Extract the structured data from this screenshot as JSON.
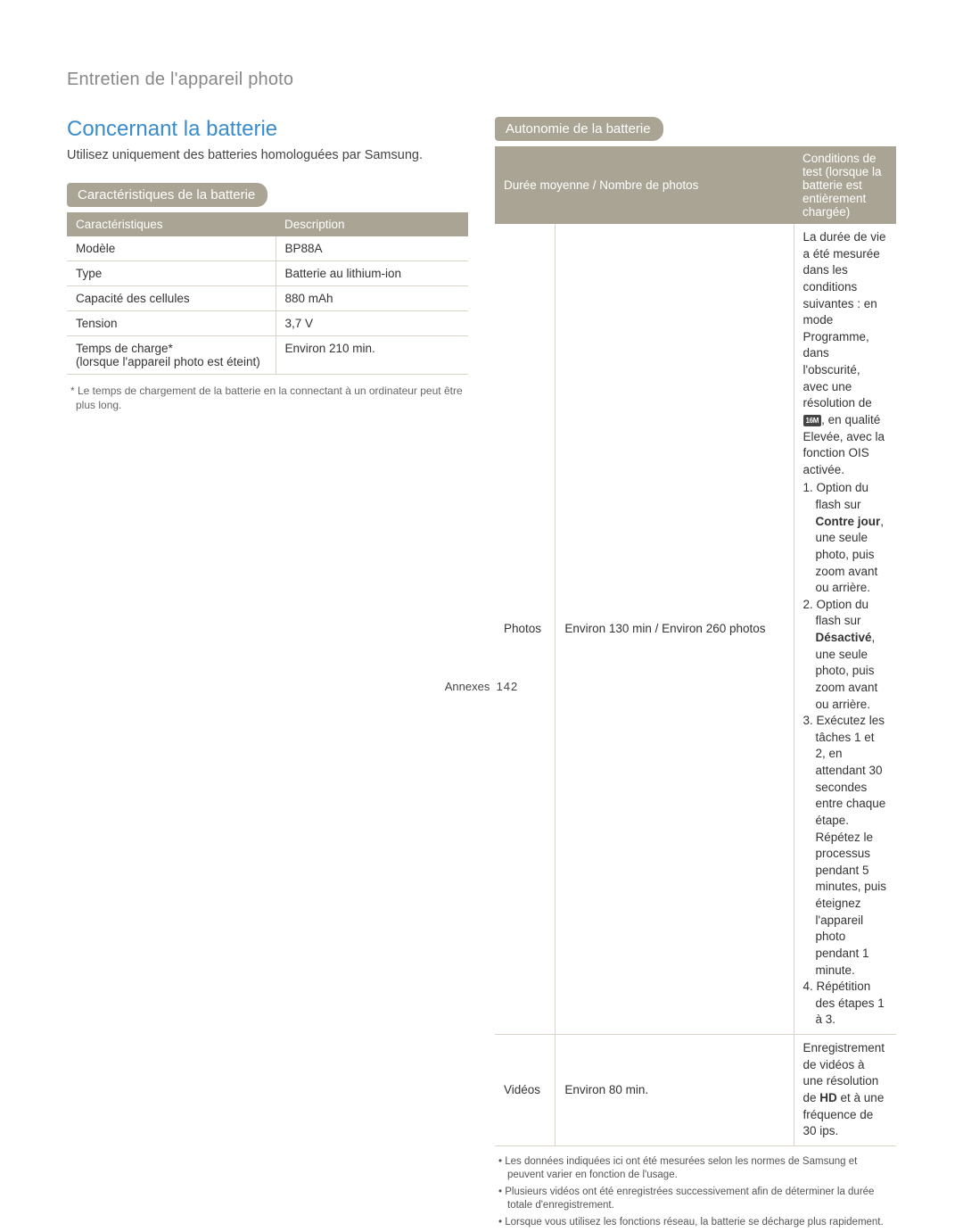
{
  "header": "Entretien de l'appareil photo",
  "section_title": "Concernant la batterie",
  "intro": "Utilisez uniquement des batteries homologuées par Samsung.",
  "flag_specs": "Caractéristiques de la batterie",
  "spec_table": {
    "head": {
      "c1": "Caractéristiques",
      "c2": "Description"
    },
    "rows": [
      {
        "c1": "Modèle",
        "c2": "BP88A"
      },
      {
        "c1": "Type",
        "c2": "Batterie au lithium-ion"
      },
      {
        "c1": "Capacité des cellules",
        "c2": "880 mAh"
      },
      {
        "c1": "Tension",
        "c2": "3,7 V"
      },
      {
        "c1_a": "Temps de charge*",
        "c1_b": "(lorsque l'appareil photo est éteint)",
        "c2": "Environ 210 min."
      }
    ]
  },
  "spec_note": "* Le temps de chargement de la batterie en la connectant à un ordinateur peut être plus long.",
  "flag_autonomy": "Autonomie de la batterie",
  "autonomy_table": {
    "head": {
      "c1": "",
      "c2": "Durée moyenne / Nombre de photos",
      "c3": "Conditions de test (lorsque la batterie est entièrement chargée)"
    },
    "photos": {
      "label": "Photos",
      "duration": "Environ 130 min / Environ 260 photos",
      "cond_intro_a": "La durée de vie a été mesurée dans les conditions suivantes : en mode Programme, dans l'obscurité, avec une résolution de ",
      "cond_intro_b": ", en qualité Elevée, avec la fonction OIS activée.",
      "li1_a": "1. Option du flash sur ",
      "li1_bold": "Contre jour",
      "li1_b": ", une seule photo, puis zoom avant ou arrière.",
      "li2_a": "2. Option du flash sur ",
      "li2_bold": "Désactivé",
      "li2_b": ", une seule photo, puis zoom avant ou arrière.",
      "li3": "3. Exécutez les tâches 1 et 2, en attendant 30 secondes entre chaque étape. Répétez le processus pendant 5 minutes, puis éteignez l'appareil photo pendant 1 minute.",
      "li4": "4. Répétition des étapes 1 à 3."
    },
    "videos": {
      "label": "Vidéos",
      "duration": "Environ 80 min.",
      "cond_a": "Enregistrement de vidéos à une résolution de ",
      "cond_hd": "HD",
      "cond_b": " et à une fréquence de 30 ips."
    }
  },
  "bullets": [
    "Les données indiquées ici ont été mesurées selon les normes de Samsung et peuvent varier en fonction de l'usage.",
    "Plusieurs vidéos ont été enregistrées successivement afin de déterminer la durée totale d'enregistrement.",
    "Lorsque vous utilisez les fonctions réseau, la batterie se décharge plus rapidement."
  ],
  "icon16m": "16M",
  "footer": {
    "label": "Annexes",
    "page": "142"
  }
}
